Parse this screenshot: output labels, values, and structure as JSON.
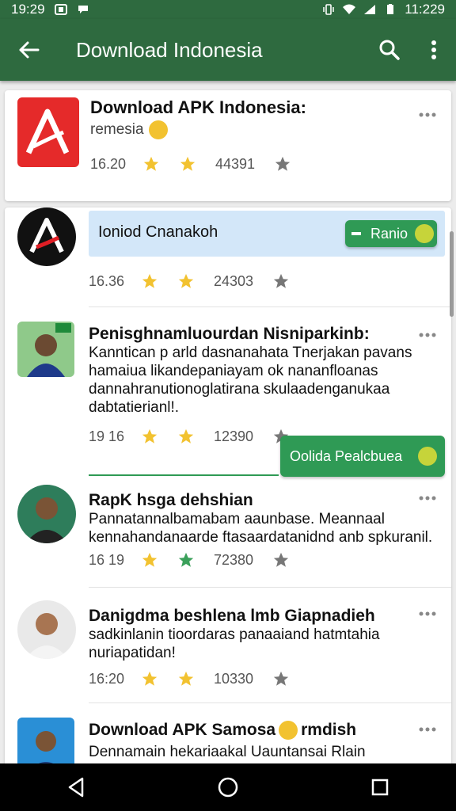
{
  "status_bar": {
    "time_left": "19:29",
    "time_right": "11:229"
  },
  "app_bar": {
    "title": "Download Indonesia"
  },
  "icons": {
    "back": "arrow-back-icon",
    "search": "search-icon",
    "overflow": "more-vert-icon",
    "item_more": "more-horiz-icon",
    "star": "star-icon",
    "nav_back": "triangle-back-icon",
    "nav_home": "circle-home-icon",
    "nav_recents": "square-recents-icon"
  },
  "colors": {
    "primary": "#2e6a3f",
    "accent_button": "#2f9a55",
    "star_gold": "#f2c230",
    "star_green": "#3aa05a",
    "highlight": "#d3e7f9"
  },
  "top_card": {
    "title": "Download APK Indonesia:",
    "subtitle": "remesia",
    "time": "16.20",
    "count": "44391"
  },
  "search_item": {
    "input_text": "Ioniod Cnanakoh",
    "button_label": "Ranio",
    "time": "16.36",
    "count": "24303"
  },
  "items": [
    {
      "title": "Penisghnamluourdan Nisniparkinb:",
      "desc_lines": [
        "Kanntican p arld dasnanahata Tnerjakan pavans",
        "hamaiua likandepaniayam ok nananfloanas",
        "dannahranutionoglatirana skulaadenganukaa",
        "dabtatierianl!."
      ],
      "time": "19 16",
      "count": "12390",
      "button_label": "Oolida Pealcbuea"
    },
    {
      "title": "RapK  hsga dehshian",
      "desc_lines": [
        "Pannatannalbamabam aaunbase. Meannaal",
        "kennahandanaarde ftasaardatanidnd anb spkuranil."
      ],
      "time": "16 19",
      "count": "72380"
    },
    {
      "title": "Danigdma beshlena lmb Giapnadieh",
      "desc_lines": [
        "sadkinlanin tioordaras panaaiand hatmtahia",
        "nuriapatidan!"
      ],
      "time": "16:20",
      "count": "10330"
    },
    {
      "title": "Download APK Samosa",
      "title_suffix": "rmdish",
      "desc_lines": [
        "Dennamain hekariaakal Uauntansai Rlain"
      ]
    }
  ]
}
